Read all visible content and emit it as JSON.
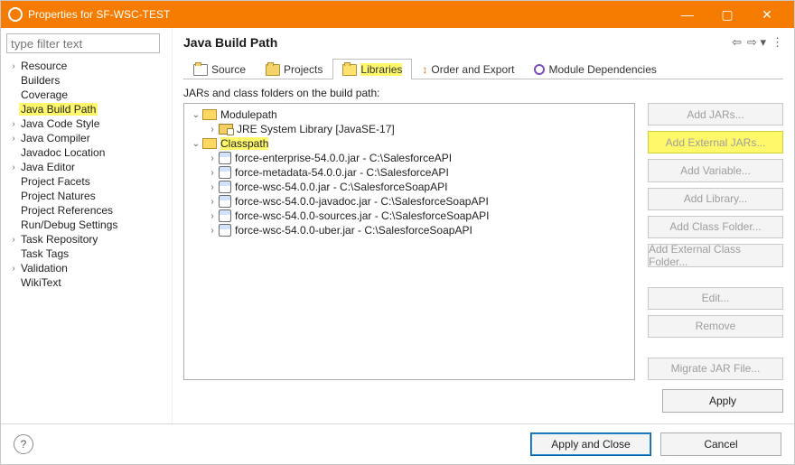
{
  "window": {
    "title": "Properties for SF-WSC-TEST"
  },
  "filter": {
    "placeholder": "type filter text"
  },
  "nav": {
    "items": [
      {
        "label": "Resource",
        "exp": true
      },
      {
        "label": "Builders",
        "exp": false
      },
      {
        "label": "Coverage",
        "exp": false
      },
      {
        "label": "Java Build Path",
        "exp": false,
        "hl": true
      },
      {
        "label": "Java Code Style",
        "exp": true
      },
      {
        "label": "Java Compiler",
        "exp": true
      },
      {
        "label": "Javadoc Location",
        "exp": false
      },
      {
        "label": "Java Editor",
        "exp": true
      },
      {
        "label": "Project Facets",
        "exp": false
      },
      {
        "label": "Project Natures",
        "exp": false
      },
      {
        "label": "Project References",
        "exp": false
      },
      {
        "label": "Run/Debug Settings",
        "exp": false
      },
      {
        "label": "Task Repository",
        "exp": true
      },
      {
        "label": "Task Tags",
        "exp": false
      },
      {
        "label": "Validation",
        "exp": true
      },
      {
        "label": "WikiText",
        "exp": false
      }
    ]
  },
  "page": {
    "title": "Java Build Path",
    "tabs": {
      "source": "Source",
      "projects": "Projects",
      "libraries": "Libraries",
      "order": "Order and Export",
      "deps": "Module Dependencies"
    },
    "list_label": "JARs and class folders on the build path:",
    "tree": {
      "modulepath": "Modulepath",
      "jre": "JRE System Library [JavaSE-17]",
      "classpath": "Classpath",
      "classpath_hl": true,
      "jars": [
        "force-enterprise-54.0.0.jar - C:\\SalesforceAPI",
        "force-metadata-54.0.0.jar - C:\\SalesforceAPI",
        "force-wsc-54.0.0.jar - C:\\SalesforceSoapAPI",
        "force-wsc-54.0.0-javadoc.jar - C:\\SalesforceSoapAPI",
        "force-wsc-54.0.0-sources.jar - C:\\SalesforceSoapAPI",
        "force-wsc-54.0.0-uber.jar - C:\\SalesforceSoapAPI"
      ]
    },
    "buttons": {
      "add_jars": "Add JARs...",
      "add_ext": "Add External JARs...",
      "add_var": "Add Variable...",
      "add_lib": "Add Library...",
      "add_cf": "Add Class Folder...",
      "add_ecf": "Add External Class Folder...",
      "edit": "Edit...",
      "remove": "Remove",
      "migrate": "Migrate JAR File..."
    },
    "apply": "Apply"
  },
  "footer": {
    "apply_close": "Apply and Close",
    "cancel": "Cancel"
  }
}
